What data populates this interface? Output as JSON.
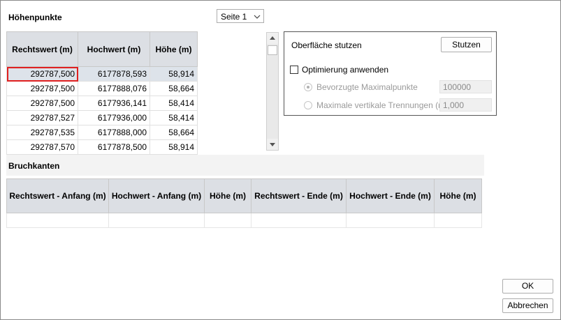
{
  "heights": {
    "title": "Höhenpunkte",
    "page_select": "Seite 1",
    "columns": [
      "Rechtswert (m)",
      "Hochwert (m)",
      "Höhe (m)"
    ],
    "rows": [
      [
        "292787,500",
        "6177878,593",
        "58,914"
      ],
      [
        "292787,500",
        "6177888,076",
        "58,664"
      ],
      [
        "292787,500",
        "6177936,141",
        "58,414"
      ],
      [
        "292787,527",
        "6177936,000",
        "58,414"
      ],
      [
        "292787,535",
        "6177888,000",
        "58,664"
      ],
      [
        "292787,570",
        "6177878,500",
        "58,914"
      ]
    ]
  },
  "options": {
    "clip_surface_label": "Oberfläche stutzen",
    "clip_button": "Stutzen",
    "optimize_label": "Optimierung anwenden",
    "preferred_max_points_label": "Bevorzugte Maximalpunkte",
    "preferred_max_points_value": "100000",
    "max_vertical_sep_label": "Maximale vertikale Trennungen (m)",
    "max_vertical_sep_value": "1,000"
  },
  "breaklines": {
    "title": "Bruchkanten",
    "columns": [
      "Rechtswert - Anfang (m)",
      "Hochwert - Anfang (m)",
      "Höhe (m)",
      "Rechtswert - Ende (m)",
      "Hochwert - Ende (m)",
      "Höhe (m)"
    ]
  },
  "footer": {
    "ok": "OK",
    "cancel": "Abbrechen"
  }
}
